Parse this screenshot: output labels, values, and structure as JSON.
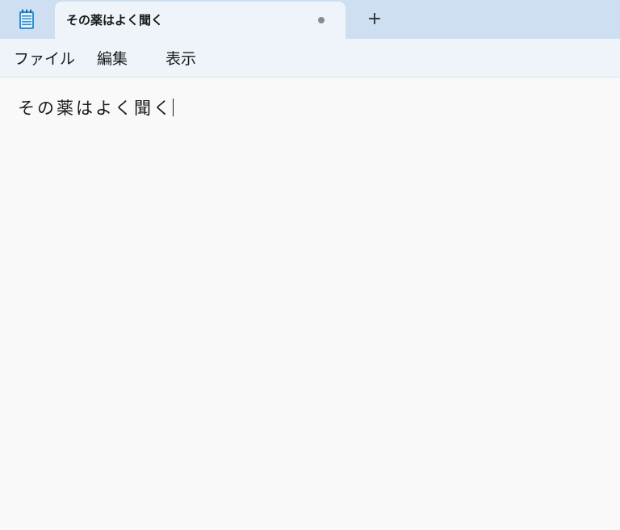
{
  "window": {
    "app_icon": "notepad-icon"
  },
  "tab": {
    "title": "その薬はよく聞く",
    "dirty_indicator": "unsaved-dot-icon"
  },
  "new_tab": {
    "label": "+"
  },
  "menu": {
    "file": "ファイル",
    "edit": "編集",
    "view": "表示"
  },
  "editor": {
    "text": "その薬はよく聞く"
  },
  "colors": {
    "titlebar": "#cddff0",
    "tab": "#eef4fa",
    "editor_bg": "#f9f9f9"
  }
}
